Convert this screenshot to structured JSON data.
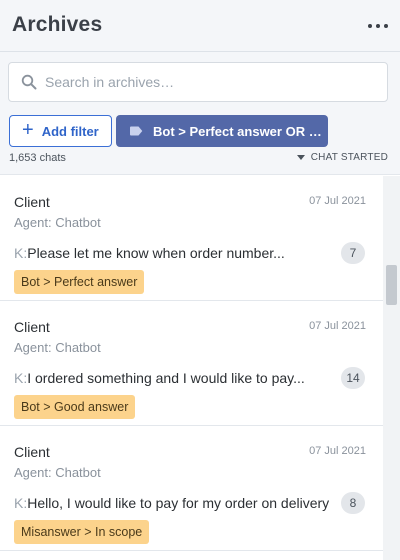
{
  "header": {
    "title": "Archives",
    "more_icon": "more-horizontal-icon"
  },
  "search": {
    "placeholder": "Search in archives…",
    "value": "",
    "icon": "search-icon"
  },
  "filters": {
    "add_filter_label": "Add filter",
    "add_icon": "plus-icon",
    "active_filter": {
      "label": "Bot > Perfect answer OR …",
      "icon": "tag-icon"
    }
  },
  "summary": {
    "count_text": "1,653 chats",
    "sort_label": "CHAT STARTED",
    "sort_icon": "caret-down-icon"
  },
  "colors": {
    "accent": "#3b6fd6",
    "chip": "#5368a8",
    "tag": "#fcd38c",
    "badge": "#e3e6ea"
  },
  "chats": [
    {
      "client": "Client",
      "date": "07 Jul 2021",
      "agent": "Agent: Chatbot",
      "prefix": "K:",
      "message": "Please let me know when order number...",
      "count": "7",
      "tag": "Bot > Perfect answer"
    },
    {
      "client": "Client",
      "date": "07 Jul 2021",
      "agent": "Agent: Chatbot",
      "prefix": "K:",
      "message": "I ordered something and I would like to pay...",
      "count": "14",
      "tag": "Bot > Good answer"
    },
    {
      "client": "Client",
      "date": "07 Jul 2021",
      "agent": "Agent: Chatbot",
      "prefix": "K:",
      "message": "Hello, I would like to pay for my order on delivery",
      "count": "8",
      "tag": "Misanswer > In scope"
    }
  ]
}
